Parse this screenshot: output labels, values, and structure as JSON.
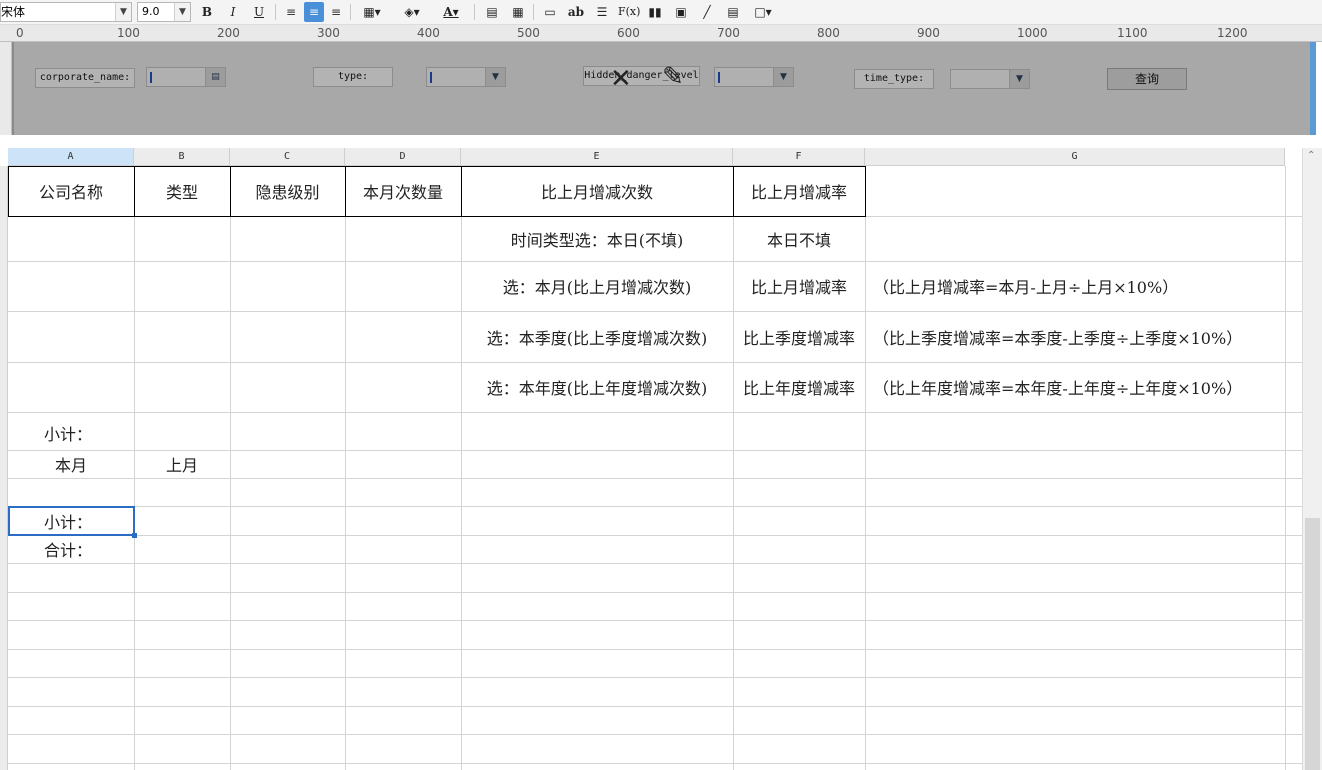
{
  "toolbar": {
    "font_name": "宋体",
    "font_size": "9.0",
    "bold": "B",
    "italic": "I",
    "underline": "U",
    "text_tool": "ab",
    "formula": "F(x)"
  },
  "ruler": {
    "labels": [
      "0",
      "100",
      "200",
      "300",
      "400",
      "500",
      "600",
      "700",
      "800",
      "900",
      "1000",
      "1100",
      "1200"
    ]
  },
  "params": {
    "corporate_name_label": "corporate_name:",
    "type_label": "type:",
    "hidden_label": "Hidden_danger_level",
    "time_type_label": "time_type:",
    "query_button": "查询"
  },
  "columns": [
    "A",
    "B",
    "C",
    "D",
    "E",
    "F",
    "G"
  ],
  "header_row": {
    "a": "公司名称",
    "b": "类型",
    "c": "隐患级别",
    "d": "本月次数量",
    "e": "比上月增减次数",
    "f": "比上月增减率"
  },
  "rows": {
    "r2_e": "时间类型选：本日(不填)",
    "r2_f": "本日不填",
    "r3_e": "选：本月(比上月增减次数)",
    "r3_f": "比上月增减率",
    "r3_g": "（比上月增减率=本月-上月÷上月×10%）",
    "r4_e": "选：本季度(比上季度增减次数)",
    "r4_f": "比上季度增减率",
    "r4_g": "（比上季度增减率=本季度-上季度÷上季度×10%）",
    "r5_e": "选：本年度(比上年度增减次数)",
    "r5_f": "比上年度增减率",
    "r5_g": "（比上年度增减率=本年度-上年度÷上年度×10%）",
    "r6_a": "小计：",
    "r7_a": "本月",
    "r7_b": "上月",
    "r9_a": "小计：",
    "r10_a": "合计："
  }
}
